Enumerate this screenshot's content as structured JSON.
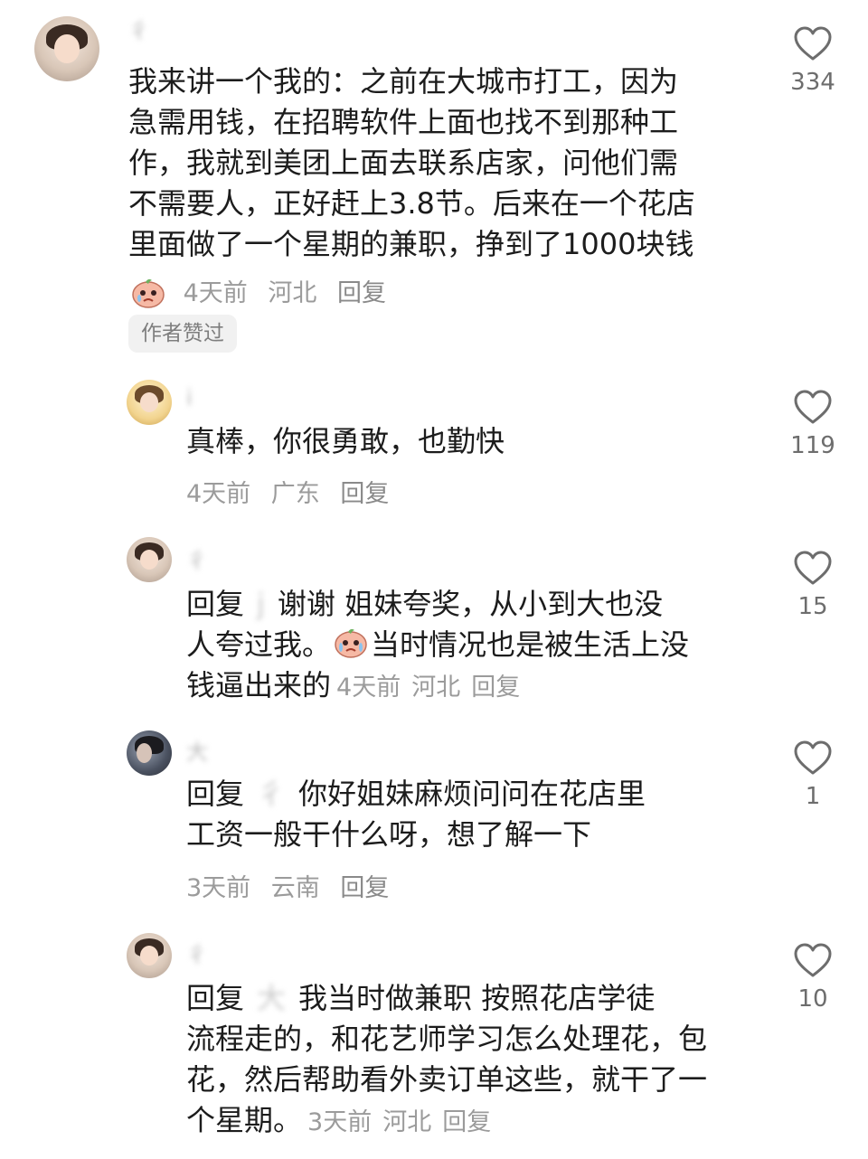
{
  "comments": [
    {
      "username": "彳",
      "text": "我来讲一个我的：之前在大城市打工，因为急需用钱，在招聘软件上面也找不到那种工作，我就到美团上面去联系店家，问他们需不需要人，正好赶上3.8节。后来在一个花店里面做了一个星期的兼职，挣到了1000块钱",
      "lines": [
        "我来讲一个我的：之前在大城市打工，因为",
        "急需用钱，在招聘软件上面也找不到那种工",
        "作，我就到美团上面去联系店家，问他们需",
        "不需要人，正好赶上3.8节。后来在一个花店",
        "里面做了一个星期的兼职，挣到了1000块钱"
      ],
      "time": "4天前",
      "location": "河北",
      "reply_label": "回复",
      "badge": "作者赞过",
      "likes": "334"
    },
    {
      "username": "i",
      "text": "真棒，你很勇敢，也勤快",
      "time": "4天前",
      "location": "广东",
      "reply_label": "回复",
      "likes": "119"
    },
    {
      "username": "彳",
      "reply_prefix": "回复",
      "mention": "j",
      "line1_rest": "谢谢 姐妹夸奖，从小到大也没",
      "line2_a": "人夸过我。",
      "line2_b": "当时情况也是被生活上没",
      "line3": "钱逼出来的",
      "time": "4天前",
      "location": "河北",
      "reply_label": "回复",
      "likes": "15"
    },
    {
      "username": "大",
      "reply_prefix": "回复",
      "mention": "彳",
      "line1_rest": "你好姐妹麻烦问问在花店里",
      "line2": "工资一般干什么呀，想了解一下",
      "time": "3天前",
      "location": "云南",
      "reply_label": "回复",
      "likes": "1"
    },
    {
      "username": "彳",
      "reply_prefix": "回复",
      "mention": "大",
      "line1_rest": "我当时做兼职 按照花店学徒",
      "line2": "流程走的，和花艺师学习怎么处理花，包",
      "line3": "花，然后帮助看外卖订单这些，就干了一",
      "line4": "个星期。",
      "time": "3天前",
      "location": "河北",
      "reply_label": "回复",
      "likes": "10"
    }
  ],
  "icons": {
    "like": "heart-outline-icon",
    "sticker_face": "crying-peach-sticker-icon"
  },
  "colors": {
    "text": "#1c1c1c",
    "meta": "#9b9b9b",
    "badge_bg": "#f1f1f1",
    "icon": "#6d6d6d"
  }
}
